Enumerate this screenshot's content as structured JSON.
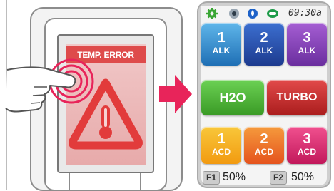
{
  "left_panel": {
    "error_title": "TEMP. ERROR",
    "icons": [
      "hand-pointer-icon",
      "touch-ripple-icon",
      "warning-triangle-icon",
      "thermometer-icon"
    ]
  },
  "arrow": {
    "color": "#e8245a",
    "icon": "right-arrow-icon"
  },
  "right_panel": {
    "status_icons": [
      "gear-icon",
      "eye-icon",
      "water-drop-icon",
      "filter-icon"
    ],
    "time": "09:30a",
    "buttons": [
      {
        "num": "1",
        "label": "ALK"
      },
      {
        "num": "2",
        "label": "ALK"
      },
      {
        "num": "3",
        "label": "ALK"
      },
      {
        "label": "H2O"
      },
      {
        "label": "TURBO"
      },
      {
        "num": "1",
        "label": "ACD"
      },
      {
        "num": "2",
        "label": "ACD"
      },
      {
        "num": "3",
        "label": "ACD"
      }
    ],
    "filters": [
      {
        "tag": "F1",
        "value": "50%"
      },
      {
        "tag": "F2",
        "value": "50%"
      }
    ]
  }
}
